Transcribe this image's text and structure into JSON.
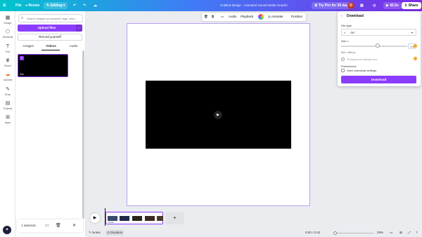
{
  "colors": {
    "brand": "#8b3dff",
    "topbar_start": "#00c4cc",
    "topbar_end": "#7d2ae8",
    "pro": "#f5a623"
  },
  "topbar": {
    "file": "File",
    "resize": "Resize",
    "editing": "Editing",
    "title": "Untitled design - Animated Social Media Graphic",
    "trial": "Try Pro for 30 days",
    "avatar_initial": "D",
    "count": "42.5s",
    "share": "Share"
  },
  "rail": [
    {
      "label": "Design",
      "icon": "▦"
    },
    {
      "label": "Elements",
      "icon": "⬡"
    },
    {
      "label": "Text",
      "icon": "T"
    },
    {
      "label": "Brand",
      "icon": "♛"
    },
    {
      "label": "Uploads",
      "icon": "☁"
    },
    {
      "label": "Draw",
      "icon": "✎"
    },
    {
      "label": "Projects",
      "icon": "▤"
    },
    {
      "label": "Apps",
      "icon": "⊞"
    }
  ],
  "panel": {
    "search_placeholder": "Search images by keyword, tags, color...",
    "upload": "Upload files",
    "record": "Record yourself",
    "tabs": [
      "Images",
      "Videos",
      "Audio"
    ],
    "active_tab": "Videos",
    "thumb_duration": "42s"
  },
  "selection": {
    "text": "1 selected"
  },
  "context": {
    "audio": "Audio",
    "playback": "Playback",
    "animate": "Animate",
    "position": "Position"
  },
  "download": {
    "title": "Download",
    "file_type_label": "File type",
    "file_type": "GIF",
    "size_label": "Size ×",
    "size_value": "1.6",
    "size_dims": "864 × 864 px",
    "transparent": "Transparent background",
    "preferences": "Preferences",
    "save_settings": "Save download settings",
    "button": "Download"
  },
  "timeline": {
    "clip_label": "42.5s"
  },
  "footer": {
    "notes": "Notes",
    "duration": "Duration",
    "time": "0:00 / 0:42",
    "zoom": "29%"
  }
}
